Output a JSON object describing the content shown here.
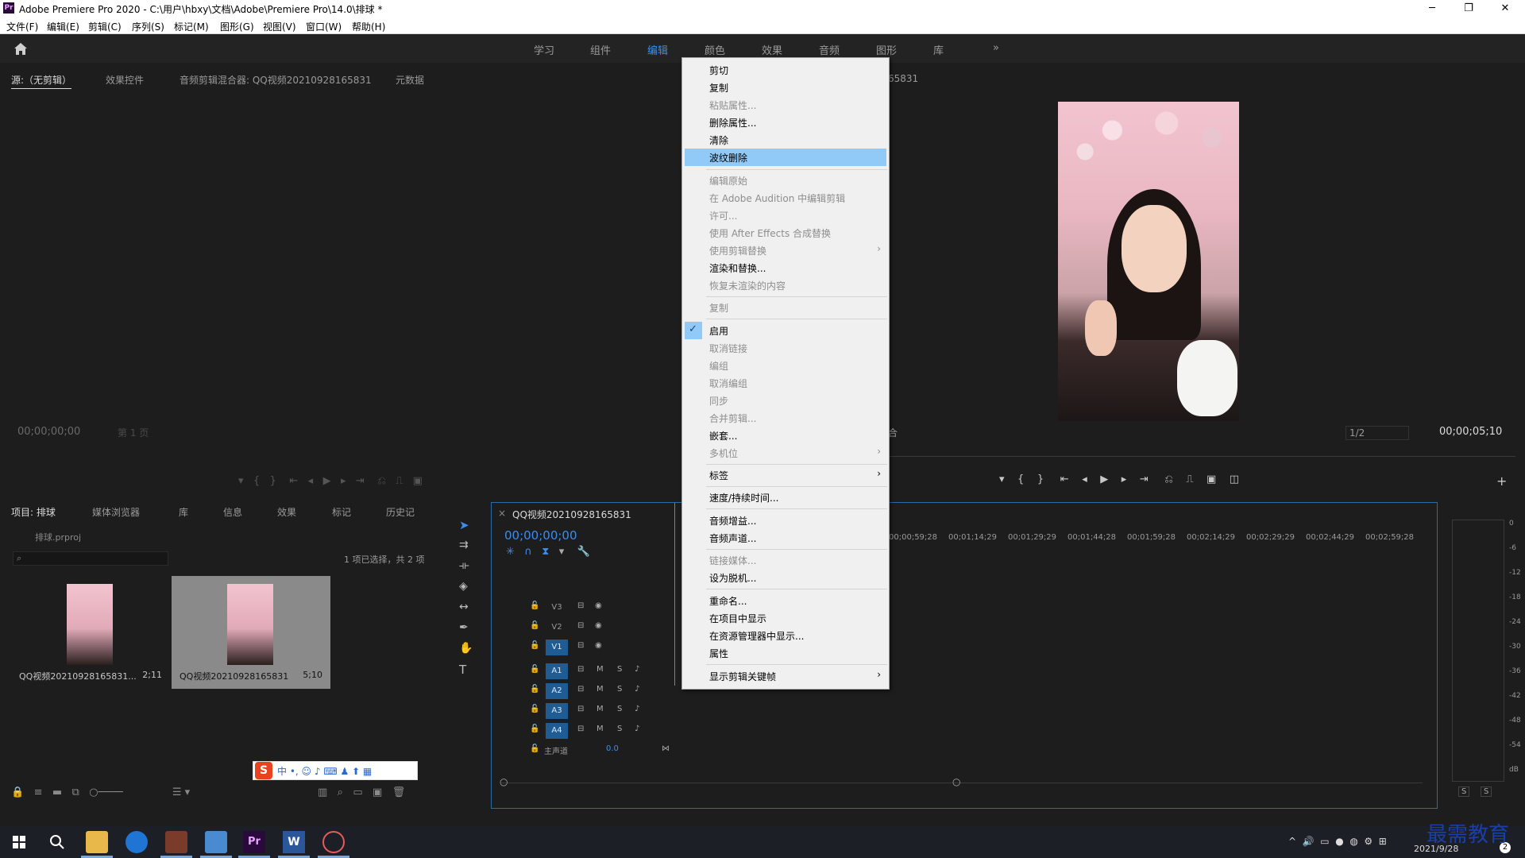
{
  "window": {
    "app_icon": "Pr",
    "title": "Adobe Premiere Pro 2020 - C:\\用户\\hbxy\\文档\\Adobe\\Premiere Pro\\14.0\\排球 *",
    "minimize": "─",
    "maximize": "❐",
    "close": "✕"
  },
  "menubar": [
    "文件(F)",
    "编辑(E)",
    "剪辑(C)",
    "序列(S)",
    "标记(M)",
    "图形(G)",
    "视图(V)",
    "窗口(W)",
    "帮助(H)"
  ],
  "workspaces": {
    "tabs": [
      "学习",
      "组件",
      "编辑",
      "颜色",
      "效果",
      "音频",
      "图形",
      "库"
    ],
    "active": "编辑",
    "more": "»"
  },
  "source_panel": {
    "tabs": [
      "源:（无剪辑）",
      "效果控件",
      "音频剪辑混合器: QQ视频20210928165831",
      "元数据"
    ],
    "timecode": "00;00;00;00",
    "page": "第 1 页"
  },
  "program_panel": {
    "title_fragment": "65831",
    "fit_fragment": "合",
    "resolution": "1/2",
    "timecode": "00;00;05;10"
  },
  "context_menu": {
    "items": [
      {
        "label": "剪切",
        "enabled": true
      },
      {
        "label": "复制",
        "enabled": true
      },
      {
        "label": "粘贴属性...",
        "enabled": false
      },
      {
        "label": "删除属性...",
        "enabled": true
      },
      {
        "label": "清除",
        "enabled": true
      },
      {
        "label": "波纹删除",
        "enabled": true,
        "highlighted": true
      },
      {
        "label": "编辑原始",
        "enabled": false
      },
      {
        "label": "在 Adobe Audition 中编辑剪辑",
        "enabled": false
      },
      {
        "label": "许可...",
        "enabled": false
      },
      {
        "label": "使用 After Effects 合成替换",
        "enabled": false
      },
      {
        "label": "使用剪辑替换",
        "enabled": false,
        "submenu": true
      },
      {
        "label": "渲染和替换...",
        "enabled": true
      },
      {
        "label": "恢复未渲染的内容",
        "enabled": false
      },
      {
        "label": "复制",
        "enabled": false
      },
      {
        "label": "启用",
        "enabled": true,
        "checked": true
      },
      {
        "label": "取消链接",
        "enabled": false
      },
      {
        "label": "编组",
        "enabled": false
      },
      {
        "label": "取消编组",
        "enabled": false
      },
      {
        "label": "同步",
        "enabled": false
      },
      {
        "label": "合并剪辑...",
        "enabled": false
      },
      {
        "label": "嵌套...",
        "enabled": true
      },
      {
        "label": "多机位",
        "enabled": false,
        "submenu": true
      },
      {
        "label": "标签",
        "enabled": true,
        "submenu": true
      },
      {
        "label": "速度/持续时间...",
        "enabled": true
      },
      {
        "label": "音频增益...",
        "enabled": true
      },
      {
        "label": "音频声道...",
        "enabled": true
      },
      {
        "label": "链接媒体...",
        "enabled": false
      },
      {
        "label": "设为脱机...",
        "enabled": true
      },
      {
        "label": "重命名...",
        "enabled": true
      },
      {
        "label": "在项目中显示",
        "enabled": true
      },
      {
        "label": "在资源管理器中显示...",
        "enabled": true
      },
      {
        "label": "属性",
        "enabled": true
      },
      {
        "label": "显示剪辑关键帧",
        "enabled": true,
        "submenu": true
      }
    ],
    "arrow": "›",
    "check": "✓"
  },
  "project_panel": {
    "tabs": [
      "项目: 排球",
      "媒体浏览器",
      "库",
      "信息",
      "效果",
      "标记",
      "历史记"
    ],
    "file": "排球.prproj",
    "selection_info": "1 项已选择，共 2 项",
    "items": [
      {
        "name": "QQ视频20210928165831...",
        "duration": "2;11"
      },
      {
        "name": "QQ视频20210928165831",
        "duration": "5;10"
      }
    ]
  },
  "timeline": {
    "tab": "QQ视频20210928165831",
    "timecode": "00;00;00;00",
    "ruler": [
      "00;00;59;28",
      "00;01;14;29",
      "00;01;29;29",
      "00;01;44;28",
      "00;01;59;28",
      "00;02;14;29",
      "00;02;29;29",
      "00;02;44;29",
      "00;02;59;28"
    ],
    "video_tracks": [
      "V3",
      "V2",
      "V1"
    ],
    "audio_tracks": [
      "A1",
      "A2",
      "A3",
      "A4"
    ],
    "master_label": "主声道",
    "master_value": "0.0",
    "m": "M",
    "s": "S"
  },
  "meter": {
    "scale": [
      "0",
      "-6",
      "-12",
      "-18",
      "-24",
      "-30",
      "-36",
      "-42",
      "-48",
      "-54",
      "dB"
    ],
    "solo": [
      "S",
      "S"
    ]
  },
  "ime": {
    "logo": "S",
    "text": "中 •, ☺ ♪ ⌨ ♟ ⬆ ▦"
  },
  "taskbar": {
    "time": "2021/9/28",
    "watermark": "最需教育",
    "badge": "2"
  }
}
